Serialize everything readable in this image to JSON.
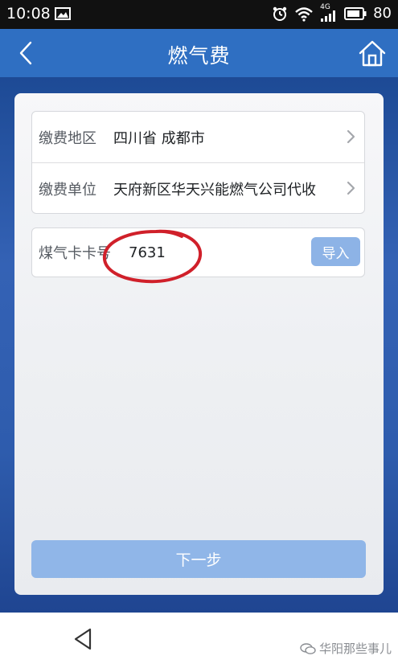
{
  "status_bar": {
    "time": "10:08",
    "network": "4G",
    "battery": "80",
    "icons": [
      "image-icon",
      "alarm-icon",
      "wifi-icon",
      "signal-icon",
      "battery-icon"
    ]
  },
  "app_bar": {
    "title": "燃气费",
    "back_icon": "chevron-left-icon",
    "home_icon": "home-icon"
  },
  "form": {
    "region": {
      "label": "缴费地区",
      "value": "四川省 成都市"
    },
    "company": {
      "label": "缴费单位",
      "value": "天府新区华天兴能燃气公司代收"
    },
    "card": {
      "label": "煤气卡卡号",
      "value": "7631",
      "import_label": "导入"
    }
  },
  "next_button": {
    "label": "下一步"
  },
  "nav_bar": {
    "back_icon": "triangle-back-icon"
  },
  "watermark": {
    "text": "华阳那些事儿"
  },
  "colors": {
    "app_bar": "#2f6fc2",
    "button": "#90b6e8",
    "annotation": "#d0202a"
  }
}
